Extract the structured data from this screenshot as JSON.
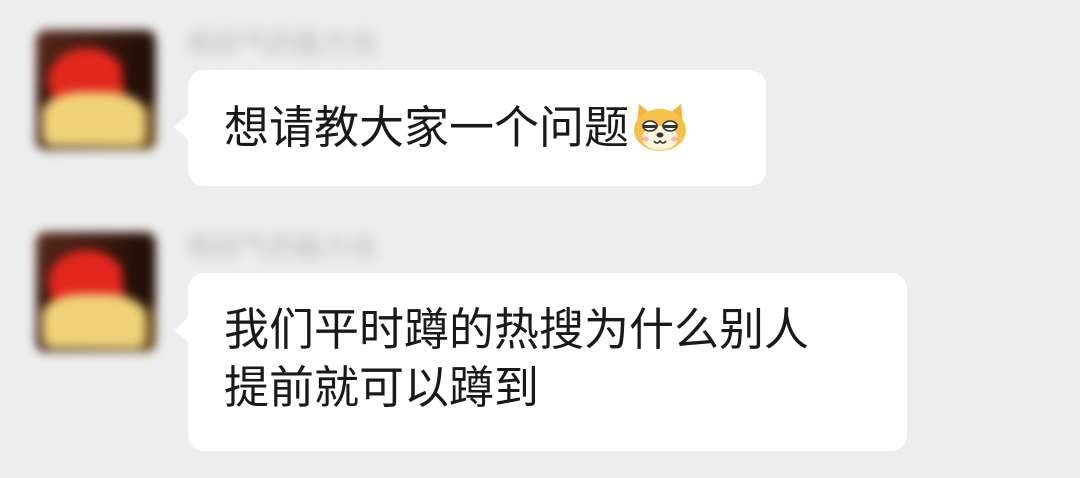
{
  "messages": [
    {
      "sender_name": "和好气的能力也",
      "lines": [
        "想请教大家一个问题"
      ],
      "emoji": "doge-face-icon"
    },
    {
      "sender_name": "和好气的能力也",
      "lines": [
        "我们平时蹲的热搜为什么别人",
        "提前就可以蹲到"
      ]
    }
  ],
  "colors": {
    "background": "#ededed",
    "bubble": "#ffffff",
    "text": "#191919"
  }
}
